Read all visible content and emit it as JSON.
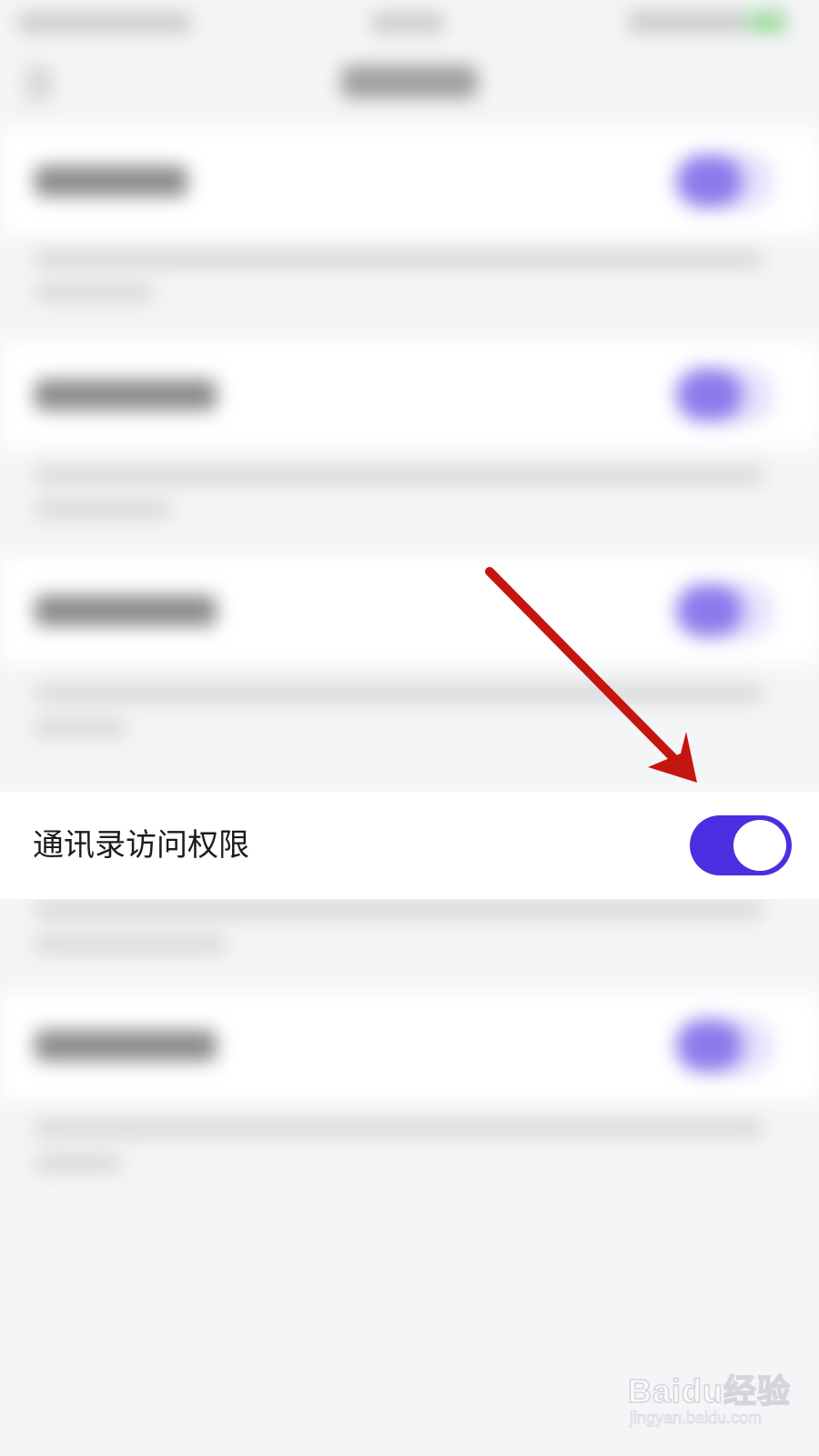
{
  "focused_row": {
    "label": "通讯录访问权限",
    "toggle_on": true,
    "toggle_color": "#4a2fe0"
  },
  "blurred_toggle_color": "#8e79ec",
  "annotation_arrow_color": "#c4150f",
  "watermark": {
    "brand": "Baidu经验",
    "url": "jingyan.baidu.com"
  }
}
